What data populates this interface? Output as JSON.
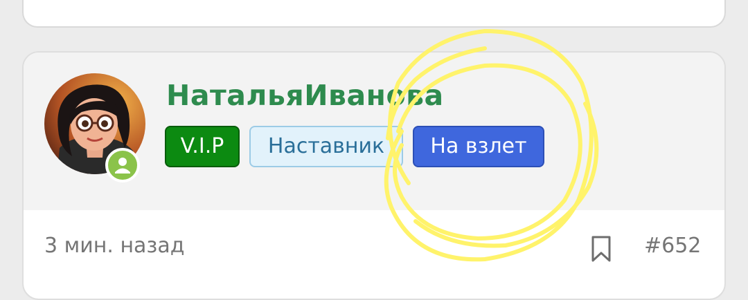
{
  "post": {
    "author": {
      "username": "НатальяИванова",
      "avatar_icon": "avatar-image",
      "status_icon": "user-icon",
      "status_color": "#8bc34a",
      "badges": [
        {
          "label": "V.I.P",
          "color": "#0c8a11"
        },
        {
          "label": "Наставник",
          "color": "#e2f2fb"
        },
        {
          "label": "На взлет",
          "color": "#3f67dd"
        }
      ]
    },
    "time_ago": "3 мин. назад",
    "bookmark_icon": "bookmark-icon",
    "post_number": "#652"
  },
  "annotation": {
    "type": "freehand-circle",
    "color": "#fff36b"
  }
}
